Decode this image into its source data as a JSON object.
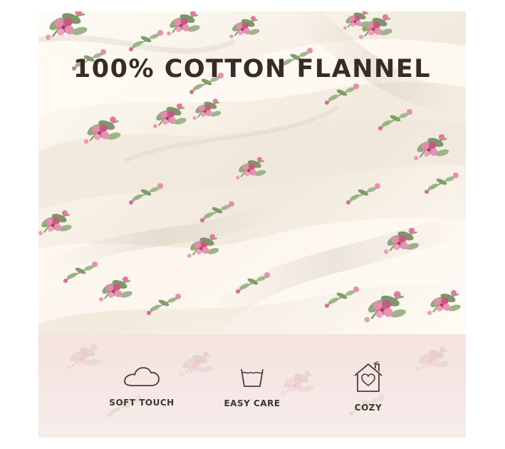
{
  "headline": "100% COTTON FLANNEL",
  "features": [
    {
      "label": "SOFT TOUCH",
      "icon": "cloud-icon"
    },
    {
      "label": "EASY CARE",
      "icon": "washing-icon"
    },
    {
      "label": "COZY",
      "icon": "home-heart-icon"
    }
  ],
  "colors": {
    "background": "#ffffff",
    "fabric": "#f8f4ec",
    "rose": "#d96a92",
    "leaf": "#8fa77b",
    "band": "#f4e6e3",
    "text": "#3a2a25"
  }
}
